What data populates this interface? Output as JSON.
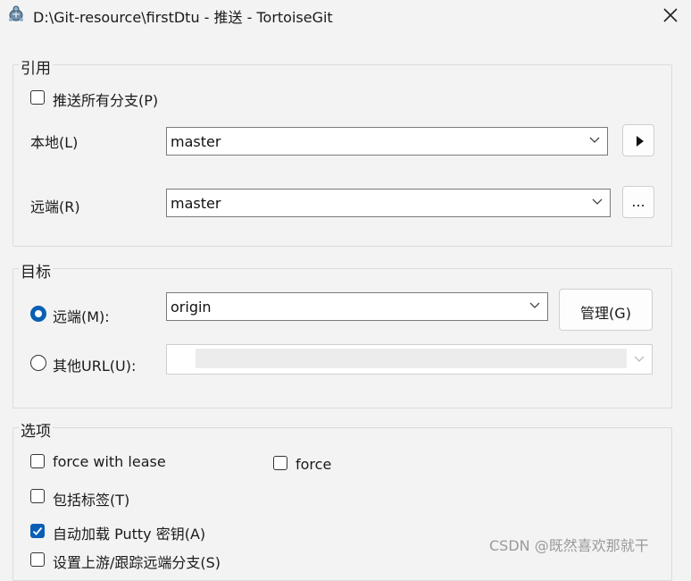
{
  "window": {
    "title": "D:\\Git-resource\\firstDtu - 推送 - TortoiseGit",
    "app_icon": "tortoisegit-icon",
    "close_icon": "close-icon"
  },
  "ref_group": {
    "title": "引用",
    "push_all_branches": {
      "label": "推送所有分支(P)",
      "checked": false
    },
    "local": {
      "label": "本地(L)",
      "value": "master",
      "button_icon": "play-arrow-icon"
    },
    "remote": {
      "label": "远端(R)",
      "value": "master",
      "button_label": "..."
    }
  },
  "dest_group": {
    "title": "目标",
    "remote_radio": {
      "label": "远端(M):",
      "checked": true,
      "value": "origin"
    },
    "manage_button": "管理(G)",
    "other_url_radio": {
      "label": "其他URL(U):",
      "checked": false,
      "value": ""
    }
  },
  "options_group": {
    "title": "选项",
    "force_with_lease": {
      "label": "force with lease",
      "checked": false
    },
    "force": {
      "label": "force",
      "checked": false
    },
    "include_tags": {
      "label": "包括标签(T)",
      "checked": false
    },
    "autoload_putty": {
      "label": "自动加载 Putty 密钥(A)",
      "checked": true
    },
    "set_upstream": {
      "label": "设置上游/跟踪远端分支(S)",
      "checked": false
    }
  },
  "watermark": "CSDN @既然喜欢那就干",
  "accent_color": "#0a5fb4"
}
